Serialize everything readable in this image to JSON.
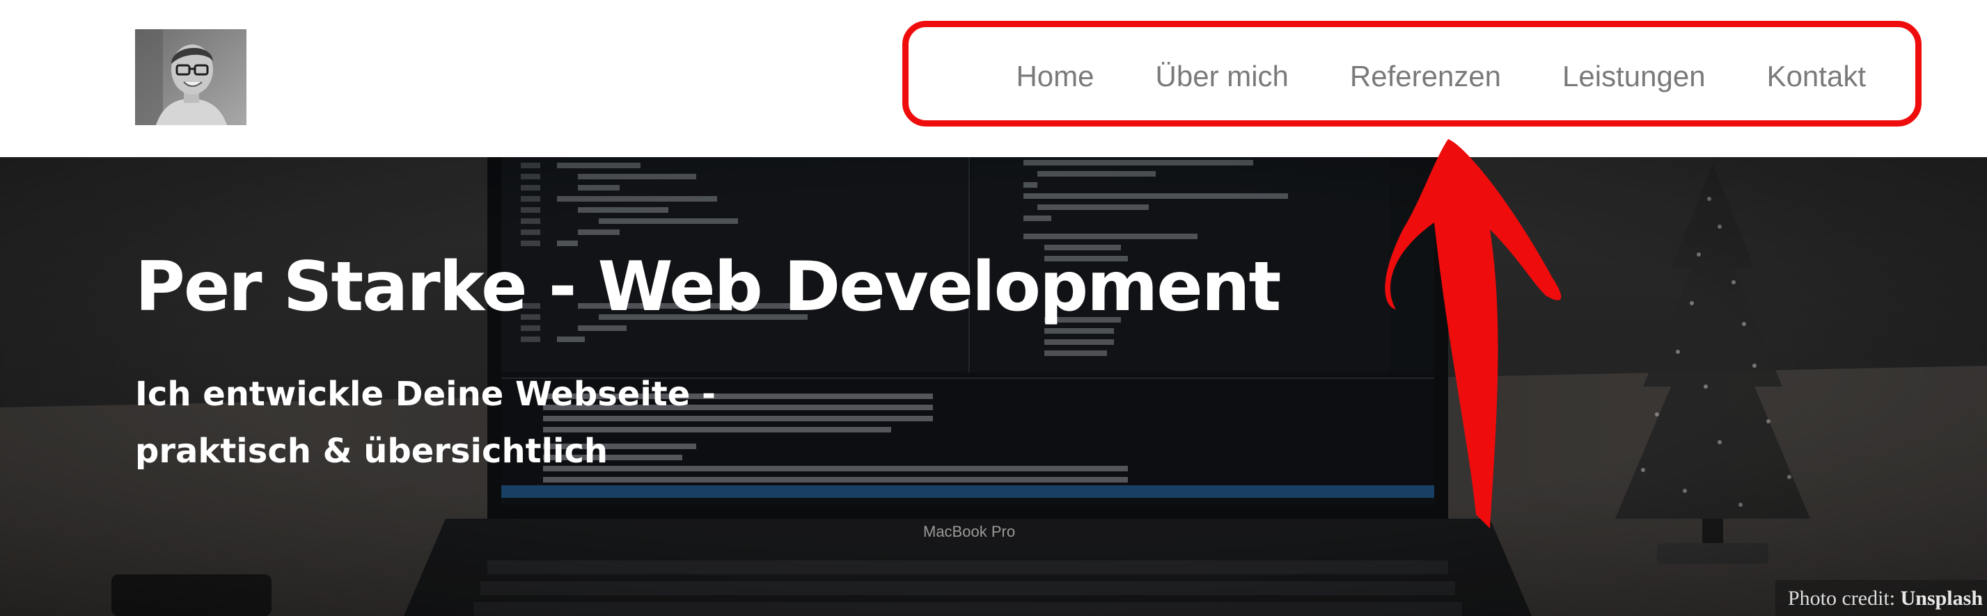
{
  "header": {
    "avatar_alt": "Portrait photo",
    "nav": [
      {
        "label": "Home"
      },
      {
        "label": "Über mich"
      },
      {
        "label": "Referenzen"
      },
      {
        "label": "Leistungen"
      },
      {
        "label": "Kontakt"
      }
    ]
  },
  "hero": {
    "title": "Per Starke - Web Development",
    "subtitle_line1": "Ich entwickle Deine Webseite -",
    "subtitle_line2": "praktisch & übersichtlich",
    "laptop_label": "MacBook Pro",
    "photo_credit_prefix": "Photo credit: ",
    "photo_credit_source": "Unsplash"
  },
  "annotation": {
    "highlight_color": "#ef0c0c"
  },
  "colors": {
    "nav_text": "#7a7a7a",
    "hero_text": "#ffffff"
  }
}
